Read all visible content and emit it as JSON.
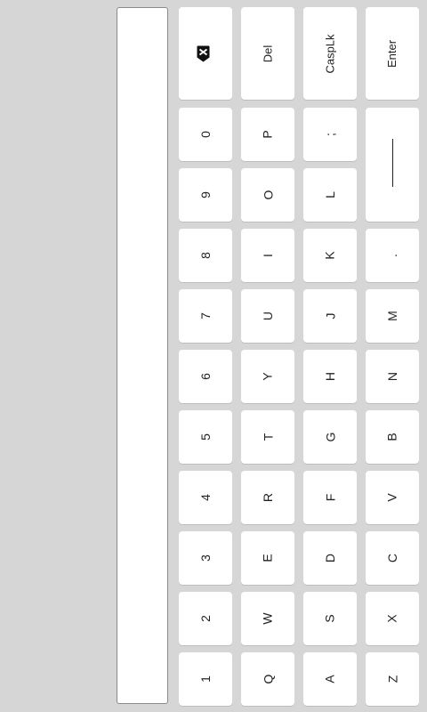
{
  "text_field": {
    "value": ""
  },
  "keys": {
    "backspace": {
      "icon": "backspace-icon"
    },
    "del": "Del",
    "capslock": "CaspLk",
    "enter": "Enter",
    "row_numbers": [
      "0",
      "9",
      "8",
      "7",
      "6",
      "5",
      "4",
      "3",
      "2",
      "1"
    ],
    "row_top": [
      "P",
      "O",
      "I",
      "U",
      "Y",
      "T",
      "R",
      "E",
      "W",
      "Q"
    ],
    "row_home": [
      ";",
      "L",
      "K",
      "J",
      "H",
      "G",
      "F",
      "D",
      "S",
      "A"
    ],
    "row_bottom": [
      ".",
      "M",
      "N",
      "B",
      "V",
      "C",
      "X",
      "Z"
    ],
    "space": {
      "icon": "space-bar"
    }
  }
}
